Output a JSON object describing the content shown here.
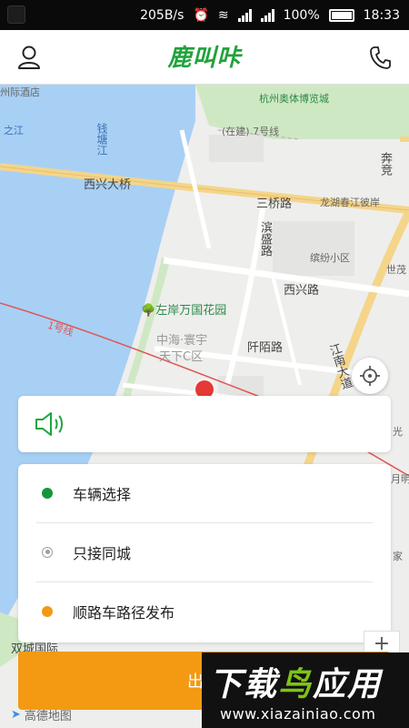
{
  "status_bar": {
    "speed": "205B/s",
    "battery": "100%",
    "time": "18:33"
  },
  "header": {
    "logo_text": "鹿叫咔"
  },
  "map": {
    "labels": {
      "hotel": "州际酒店",
      "zhijiang": "之江",
      "qiantangjiang": "钱塘江",
      "xixing_bridge": "西兴大桥",
      "hangzhou_sports": "杭州奥体博览城",
      "metro7": "(在建) 7号线",
      "sanqiao_road": "三桥路",
      "longhu": "龙湖春江彼岸",
      "binsheng_road": "滨盛路",
      "binfen": "缤纷小区",
      "xixing_road": "西兴路",
      "zuoan_garden": "左岸万国花园",
      "metro1": "1号线",
      "zhonghai": "中海·寰宇",
      "tianxia": "天下C区",
      "qianmo_road": "阡陌路",
      "jiangnan_ave": "江南大道",
      "shiji": "世茂",
      "kang": "奔竞",
      "shuangcheng": "双城国际",
      "guang": "光",
      "yue": "月明",
      "jia": "家"
    }
  },
  "options": [
    {
      "label": "车辆选择",
      "dot": "green"
    },
    {
      "label": "只接同城",
      "dot": "radio"
    },
    {
      "label": "顺路车路径发布",
      "dot": "orange"
    }
  ],
  "publish_button": {
    "label": "出"
  },
  "amap": {
    "label": "高德地图"
  },
  "watermark": {
    "title_a": "下载",
    "title_b": "鸟",
    "title_c": "应用",
    "url": "www.xiazainiao.com"
  },
  "colors": {
    "brand_green": "#1fa33c",
    "accent_orange": "#f39a12",
    "river_blue": "#a8d0f5",
    "park_green": "#cfe8c4"
  }
}
